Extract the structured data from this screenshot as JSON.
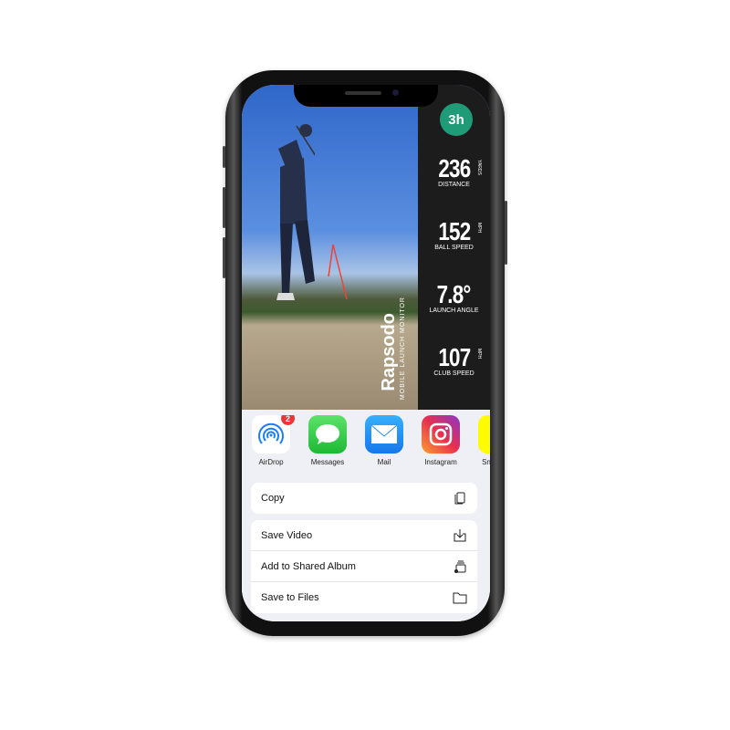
{
  "overlay": {
    "club_badge": "3h",
    "brand": "Rapsodo",
    "brand_sub": "MOBILE LAUNCH MONITOR",
    "stats": [
      {
        "value": "236",
        "unit": "YARDS",
        "label": "DISTANCE"
      },
      {
        "value": "152",
        "unit": "MPH",
        "label": "BALL SPEED"
      },
      {
        "value": "7.8°",
        "unit": "",
        "label": "LAUNCH ANGLE"
      },
      {
        "value": "107",
        "unit": "MPH",
        "label": "CLUB SPEED"
      }
    ]
  },
  "share": {
    "apps": [
      {
        "label": "AirDrop",
        "icon": "airdrop-icon",
        "badge": "2"
      },
      {
        "label": "Messages",
        "icon": "messages-icon"
      },
      {
        "label": "Mail",
        "icon": "mail-icon"
      },
      {
        "label": "Instagram",
        "icon": "instagram-icon"
      },
      {
        "label": "Snapchat",
        "icon": "snapchat-icon"
      }
    ],
    "actions": [
      {
        "label": "Copy",
        "icon": "copy-icon"
      },
      {
        "label": "Save Video",
        "icon": "save-icon"
      },
      {
        "label": "Add to Shared Album",
        "icon": "shared-album-icon"
      },
      {
        "label": "Save to Files",
        "icon": "folder-icon"
      }
    ]
  },
  "colors": {
    "accent": "#1f9b77",
    "badge": "#e53935"
  }
}
